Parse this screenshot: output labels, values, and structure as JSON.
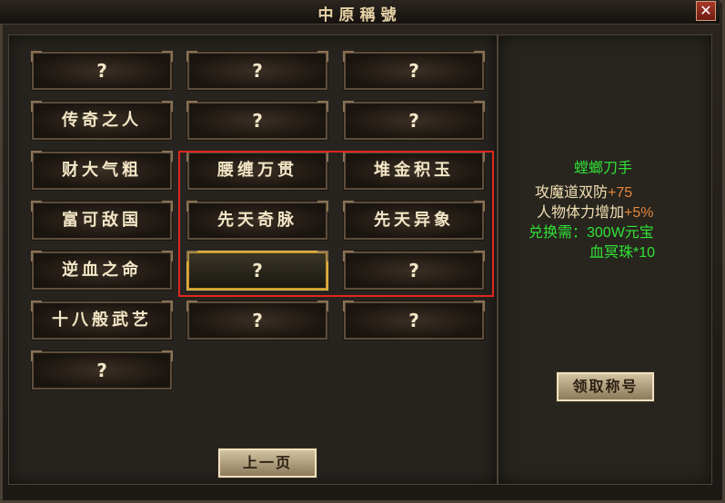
{
  "window": {
    "title": "中原稱號",
    "close": "✕"
  },
  "slots": [
    {
      "label": "?",
      "kind": "q"
    },
    {
      "label": "?",
      "kind": "q"
    },
    {
      "label": "?",
      "kind": "q"
    },
    {
      "label": "传奇之人",
      "kind": "t"
    },
    {
      "label": "?",
      "kind": "q"
    },
    {
      "label": "?",
      "kind": "q"
    },
    {
      "label": "财大气粗",
      "kind": "t"
    },
    {
      "label": "腰缠万贯",
      "kind": "t"
    },
    {
      "label": "堆金积玉",
      "kind": "t"
    },
    {
      "label": "富可敌国",
      "kind": "t"
    },
    {
      "label": "先天奇脉",
      "kind": "t"
    },
    {
      "label": "先天异象",
      "kind": "t"
    },
    {
      "label": "逆血之命",
      "kind": "t"
    },
    {
      "label": "?",
      "kind": "q",
      "selected": true
    },
    {
      "label": "?",
      "kind": "q"
    },
    {
      "label": "十八般武艺",
      "kind": "t"
    },
    {
      "label": "?",
      "kind": "q"
    },
    {
      "label": "?",
      "kind": "q"
    },
    {
      "label": "?",
      "kind": "q"
    }
  ],
  "detail": {
    "name": "螳螂刀手",
    "attr1_label": "攻魔道双防",
    "attr1_value": "+75",
    "attr2_label": "人物体力增加",
    "attr2_value": "+5%",
    "cost_line1": "兑换需：300W元宝",
    "cost_line2": "血冥珠*10"
  },
  "buttons": {
    "claim": "领取称号",
    "prev": "上一页"
  },
  "colors": {
    "highlight": "#e0261f",
    "green": "#31e235",
    "orange": "#e6863a"
  }
}
